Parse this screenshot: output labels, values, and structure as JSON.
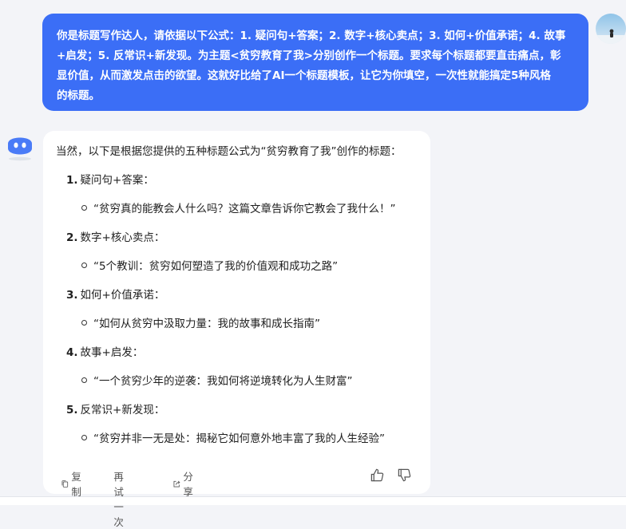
{
  "user_message": {
    "lines": [
      "你是标题写作达人，请依据以下公式：1. 疑问句+答案；2. 数字+核心卖点；3. 如何+价值承诺；4. 故事",
      "+启发；5. 反常识+新发现。为主题<贫穷教育了我>分别创作一个标题。要求每个标题都要直击痛点，彰",
      "显价值，从而激发点击的欲望。这就好比给了AI一个标题模板，让它为你填空，一次性就能搞定5种风格",
      "的标题。"
    ]
  },
  "reply": {
    "intro": "当然，以下是根据您提供的五种标题公式为“贫穷教育了我”创作的标题：",
    "items": [
      {
        "num": "1.",
        "formula": "疑问句+答案：",
        "title": "“贫穷真的能教会人什么吗？这篇文章告诉你它教会了我什么！”"
      },
      {
        "num": "2.",
        "formula": "数字+核心卖点：",
        "title": "“5个教训：贫穷如何塑造了我的价值观和成功之路”"
      },
      {
        "num": "3.",
        "formula": "如何+价值承诺：",
        "title": "“如何从贫穷中汲取力量：我的故事和成长指南”"
      },
      {
        "num": "4.",
        "formula": "故事+启发：",
        "title": "“一个贫穷少年的逆袭：我如何将逆境转化为人生财富”"
      },
      {
        "num": "5.",
        "formula": "反常识+新发现：",
        "title": "“贫穷并非一无是处：揭秘它如何意外地丰富了我的人生经验”"
      }
    ]
  },
  "actions": {
    "copy": "复制",
    "retry": "再试一次",
    "share": "分享"
  },
  "icons": {
    "copy": "copy-icon",
    "retry": "refresh-icon",
    "share": "share-icon",
    "like": "thumbs-up-icon",
    "dislike": "thumbs-down-icon",
    "bot": "robot-avatar-icon",
    "user": "user-avatar"
  },
  "colors": {
    "user_bubble": "#3b6ef6",
    "background": "#f3f4f8",
    "card": "#ffffff",
    "bot_avatar": "#4a7bf7"
  }
}
